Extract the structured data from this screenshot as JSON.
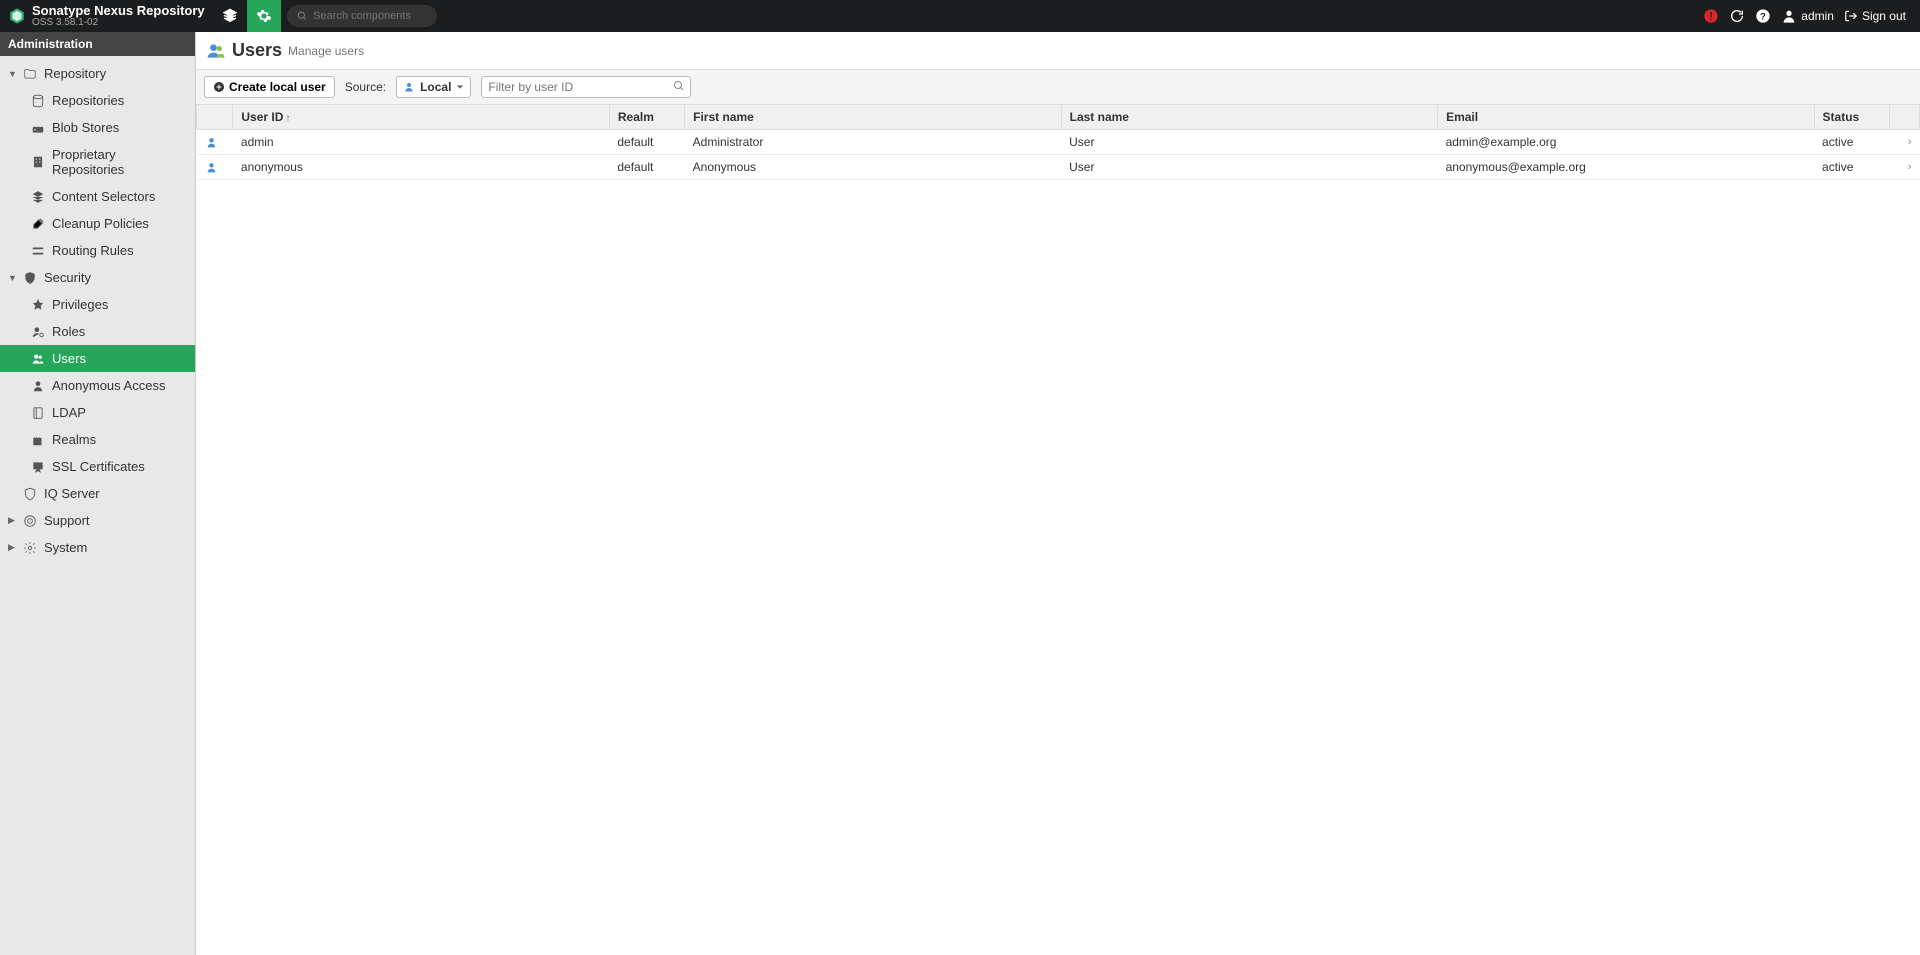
{
  "header": {
    "title": "Sonatype Nexus Repository",
    "subtitle": "OSS 3.58.1-02",
    "search_placeholder": "Search components",
    "user_label": "admin",
    "signout_label": "Sign out"
  },
  "sidebar": {
    "title": "Administration",
    "sections": [
      {
        "label": "Repository",
        "expanded": true,
        "items": [
          {
            "label": "Repositories",
            "icon": "db"
          },
          {
            "label": "Blob Stores",
            "icon": "hdd"
          },
          {
            "label": "Proprietary Repositories",
            "icon": "building"
          },
          {
            "label": "Content Selectors",
            "icon": "layers"
          },
          {
            "label": "Cleanup Policies",
            "icon": "broom"
          },
          {
            "label": "Routing Rules",
            "icon": "route"
          }
        ]
      },
      {
        "label": "Security",
        "expanded": true,
        "items": [
          {
            "label": "Privileges",
            "icon": "badge"
          },
          {
            "label": "Roles",
            "icon": "userrole"
          },
          {
            "label": "Users",
            "icon": "users",
            "selected": true
          },
          {
            "label": "Anonymous Access",
            "icon": "person"
          },
          {
            "label": "LDAP",
            "icon": "book"
          },
          {
            "label": "Realms",
            "icon": "castle"
          },
          {
            "label": "SSL Certificates",
            "icon": "cert"
          }
        ]
      },
      {
        "label": "IQ Server",
        "expanded": false,
        "leaf": true,
        "icon": "shield"
      },
      {
        "label": "Support",
        "expanded": false,
        "icon": "lifering"
      },
      {
        "label": "System",
        "expanded": false,
        "icon": "gear"
      }
    ]
  },
  "page": {
    "title": "Users",
    "subtitle": "Manage users",
    "create_button": "Create local user",
    "source_label": "Source:",
    "source_value": "Local",
    "filter_placeholder": "Filter by user ID"
  },
  "table": {
    "columns": [
      "User ID",
      "Realm",
      "First name",
      "Last name",
      "Email",
      "Status"
    ],
    "sort_col": 0,
    "rows": [
      {
        "user_id": "admin",
        "realm": "default",
        "first_name": "Administrator",
        "last_name": "User",
        "email": "admin@example.org",
        "status": "active"
      },
      {
        "user_id": "anonymous",
        "realm": "default",
        "first_name": "Anonymous",
        "last_name": "User",
        "email": "anonymous@example.org",
        "status": "active"
      }
    ]
  }
}
